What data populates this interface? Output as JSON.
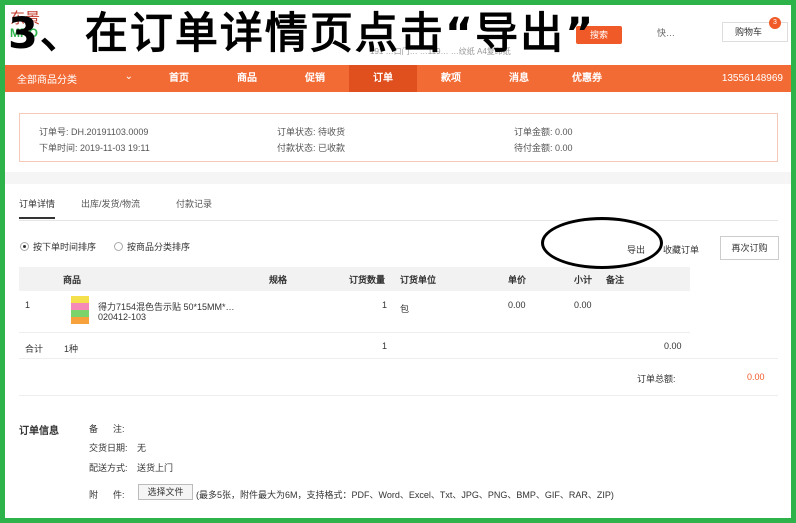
{
  "caption": "3、在订单详情页点击“导出”",
  "logo": {
    "line1": "东景",
    "line2": "MRO"
  },
  "header": {
    "hint_text": "191  …口门…  …119…  …纹纸  A4复印纸",
    "search_label": "搜索",
    "quick_order_label": "快…",
    "cart_label": "购物车",
    "cart_count": "3"
  },
  "nav": {
    "all_categories": "全部商品分类",
    "items": [
      "首页",
      "商品",
      "促销",
      "订单",
      "款项",
      "消息",
      "优惠券"
    ],
    "active_item": "订单",
    "phone": "13556148969"
  },
  "summary": {
    "order_no_label": "订单号: DH.20191103.0009",
    "order_time_label": "下单时间: 2019-11-03 19:11",
    "order_status_label": "订单状态: ",
    "order_status_value": "待收货",
    "payment_status_label": "付款状态: 已收款",
    "order_amount_label": "订单金额: 0.00",
    "pending_payment_label": "待付金额: 0.00"
  },
  "tabs": [
    "订单详情",
    "出库/发货/物流",
    "付款记录"
  ],
  "sort_options": [
    "按下单时间排序",
    "按商品分类排序"
  ],
  "actions": {
    "export": "导出",
    "favorite": "收藏订单",
    "reorder": "再次订购"
  },
  "table": {
    "headers": [
      "商品",
      "规格",
      "订货数量",
      "订货单位",
      "单价",
      "小计",
      "备注"
    ],
    "rows": [
      {
        "index": "1",
        "name": "得力7154混色告示贴 50*15MM*…",
        "code": "020412-103",
        "qty": "1",
        "unit": "包",
        "price": "0.00",
        "subtotal": "0.00"
      }
    ],
    "total": {
      "label": "合计",
      "kinds": "1种",
      "qty": "1",
      "amount": "0.00"
    },
    "grand_total_label": "订单总额:",
    "grand_total_value": "0.00"
  },
  "order_info": {
    "heading": "订单信息",
    "remark_label": "备      注:",
    "delivery_date_label": "交货日期:",
    "delivery_date_value": "无",
    "delivery_method_label": "配送方式:",
    "delivery_method_value": "送货上门",
    "attachment_label": "附      件:",
    "choose_file": "选择文件",
    "attachment_hint": "(最多5张，附件最大为6M，支持格式：PDF、Word、Excel、Txt、JPG、PNG、BMP、GIF、RAR、ZIP)"
  },
  "colors": {
    "accent": "#f26b35",
    "frame": "#2db34a",
    "status": "#f05a28"
  }
}
